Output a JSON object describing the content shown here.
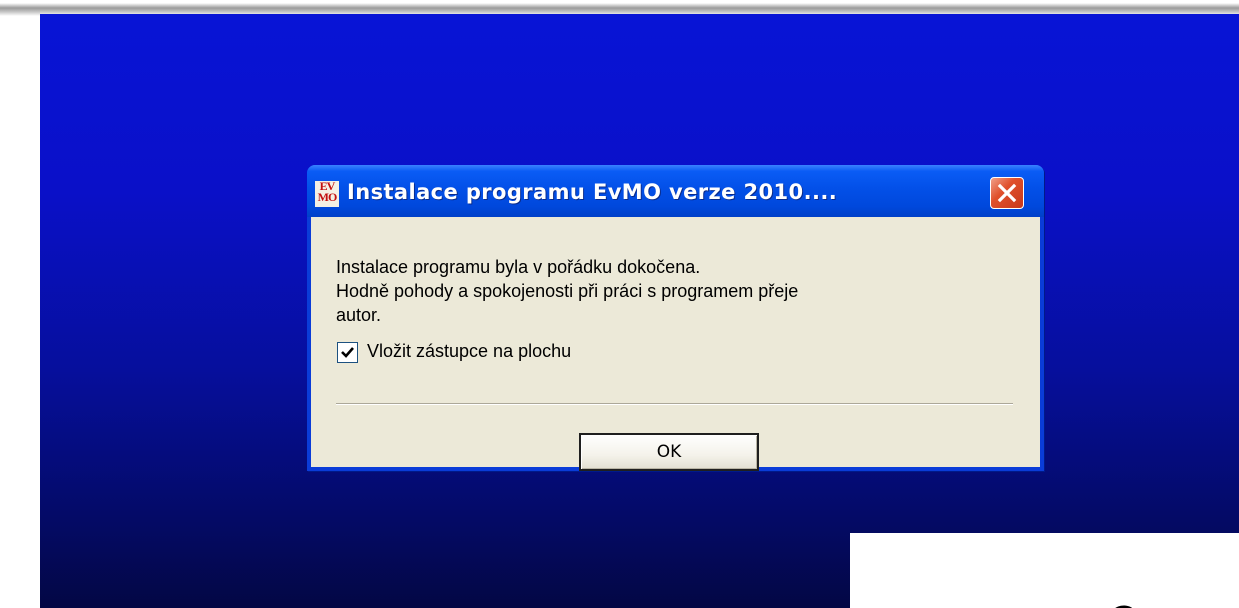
{
  "dialog": {
    "title": "Instalace programu EvMO verze 2010....",
    "app_icon": {
      "name": "evmo-app-icon",
      "line1": "EV",
      "line2": "MO"
    },
    "close_icon": "close-icon",
    "message": [
      "Instalace progrармu byla v pořádku dokočena.",
      "Hodně pohody a spokojenosti při práci s programem přeje",
      "autor."
    ],
    "checkbox": {
      "label": "Vložit zástupce na plochu",
      "checked": true
    },
    "ok_label": "OK"
  },
  "colors": {
    "desktop_top": "#0814d6",
    "desktop_bottom": "#030744",
    "titlebar": "#0350e8",
    "close_button": "#e0502c",
    "dialog_face": "#ece9d8"
  }
}
